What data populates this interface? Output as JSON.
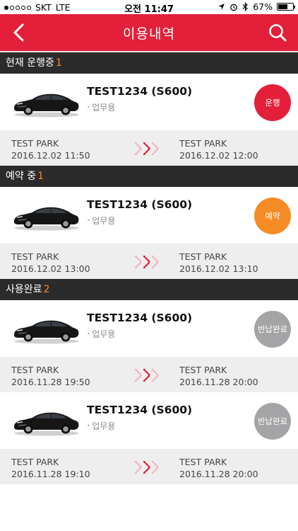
{
  "status_bar": {
    "carrier": "SKT",
    "network": "LTE",
    "time": "오전 11:47",
    "battery": "67%",
    "battery_level": 0.67
  },
  "header": {
    "title": "이용내역",
    "back_icon": "chevron-left-icon",
    "search_icon": "search-icon"
  },
  "colors": {
    "brand": "#e41f3a",
    "accent_orange": "#f58b25",
    "done_gray": "#a4a4a6"
  },
  "sections": [
    {
      "title": "현재 운행중",
      "count": "1",
      "items": [
        {
          "car_name": "TEST1234 (S600)",
          "car_type": "업무용",
          "status": "운행",
          "status_kind": "running",
          "from_place": "TEST PARK",
          "from_time": "2016.12.02 11:50",
          "to_place": "TEST PARK",
          "to_time": "2016.12.02 12:00"
        }
      ]
    },
    {
      "title": "예약 중",
      "count": "1",
      "items": [
        {
          "car_name": "TEST1234 (S600)",
          "car_type": "업무용",
          "status": "예약",
          "status_kind": "reserved",
          "from_place": "TEST PARK",
          "from_time": "2016.12.02 13:00",
          "to_place": "TEST PARK",
          "to_time": "2016.12.02 13:10"
        }
      ]
    },
    {
      "title": "사용완료",
      "count": "2",
      "items": [
        {
          "car_name": "TEST1234 (S600)",
          "car_type": "업무용",
          "status": "반납완료",
          "status_kind": "done",
          "from_place": "TEST PARK",
          "from_time": "2016.11.28 19:50",
          "to_place": "TEST PARK",
          "to_time": "2016.11.28 20:00"
        },
        {
          "car_name": "TEST1234 (S600)",
          "car_type": "업무용",
          "status": "반납완료",
          "status_kind": "done",
          "from_place": "TEST PARK",
          "from_time": "2016.11.28 19:10",
          "to_place": "TEST PARK",
          "to_time": "2016.11.28 20:00"
        }
      ]
    }
  ]
}
